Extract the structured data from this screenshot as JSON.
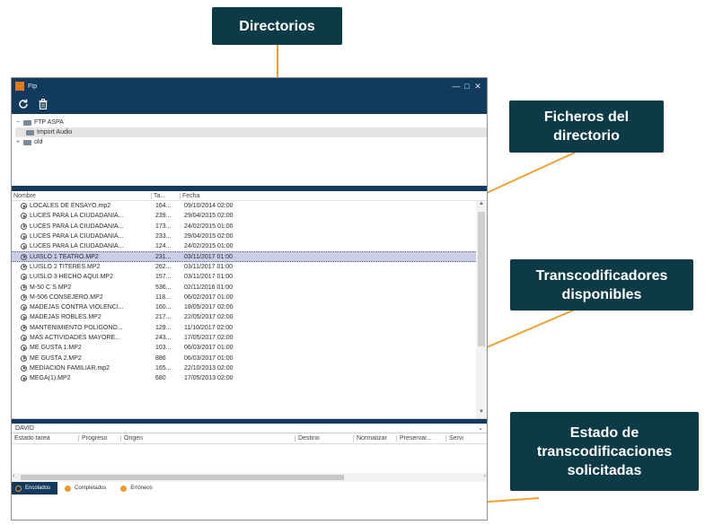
{
  "callouts": {
    "directorios": "Directorios",
    "ficheros": "Ficheros del directorio",
    "transcodificadores": "Transcodificadores disponibles",
    "estado": "Estado de transcodificaciones solicitadas"
  },
  "window": {
    "title": "Ftp",
    "controls": [
      "—",
      "□",
      "✕"
    ]
  },
  "toolbar": {
    "refresh_icon": "refresh-icon",
    "delete_icon": "trash-icon"
  },
  "tree": [
    {
      "toggle": "−",
      "label": "FTP ASPA"
    },
    {
      "toggle": "",
      "label": "Import Audio",
      "selected": true
    },
    {
      "toggle": "+",
      "label": "old"
    }
  ],
  "files": {
    "columns": [
      "Nombre",
      "Ta...",
      "Fecha"
    ],
    "rows": [
      {
        "name": "LOCALES DE ENSAYO.mp2",
        "size": "164...",
        "date": "09/10/2014 02:00"
      },
      {
        "name": "LUCES PARA LA CIUDADANIA...",
        "size": "239...",
        "date": "29/04/2015 02:00"
      },
      {
        "name": "LUCES PARA LA CIUDADANIA...",
        "size": "173...",
        "date": "24/02/2015 01:00"
      },
      {
        "name": "LUCES PARA LA CIUDADANIA...",
        "size": "233...",
        "date": "29/04/2015 02:00"
      },
      {
        "name": "LUCES PARA LA CIUDADANIA...",
        "size": "124...",
        "date": "24/02/2015 01:00"
      },
      {
        "name": "LUISLO 1 TEATRO.MP2",
        "size": "231...",
        "date": "03/11/2017 01:00",
        "selected": true
      },
      {
        "name": "LUISLO 2 TITERES.MP2",
        "size": "262...",
        "date": "03/11/2017 01:00"
      },
      {
        "name": "LUISLO 3 HECHO AQUI.MP2",
        "size": "157...",
        "date": "03/11/2017 01:00"
      },
      {
        "name": "M-50 C´S.MP2",
        "size": "536...",
        "date": "02/11/2016 01:00"
      },
      {
        "name": "M-506 CONSEJERO.MP2",
        "size": "118...",
        "date": "06/02/2017 01:00"
      },
      {
        "name": "MADEJAS CONTRA VIOLENCI...",
        "size": "160...",
        "date": "18/05/2017 02:00"
      },
      {
        "name": "MADEJAS ROBLES.MP2",
        "size": "217...",
        "date": "22/05/2017 02:00"
      },
      {
        "name": "MANTENIMIENTO POLIGONO...",
        "size": "129...",
        "date": "11/10/2017 02:00"
      },
      {
        "name": "MAS ACTIVIDADES MAYORE...",
        "size": "243...",
        "date": "17/05/2017 02:00"
      },
      {
        "name": "ME GUSTA 1.MP2",
        "size": "103...",
        "date": "06/03/2017 01:00"
      },
      {
        "name": "ME GUSTA 2.MP2",
        "size": "886",
        "date": "06/03/2017 01:00"
      },
      {
        "name": "MEDIACION FAMILIAR.mp2",
        "size": "165...",
        "date": "22/10/2013 02:00"
      },
      {
        "name": "MEGA(1).MP2",
        "size": "680",
        "date": "17/05/2013 02:00"
      }
    ]
  },
  "transcoder": {
    "selected": "DAVID"
  },
  "tasks": {
    "columns": [
      "Estado tarea",
      "Progreso",
      "Origen",
      "Destino",
      "Normalizar",
      "Preservar...",
      "Servi"
    ]
  },
  "status_tabs": [
    "Encolados",
    "Completados",
    "Erróneos"
  ]
}
